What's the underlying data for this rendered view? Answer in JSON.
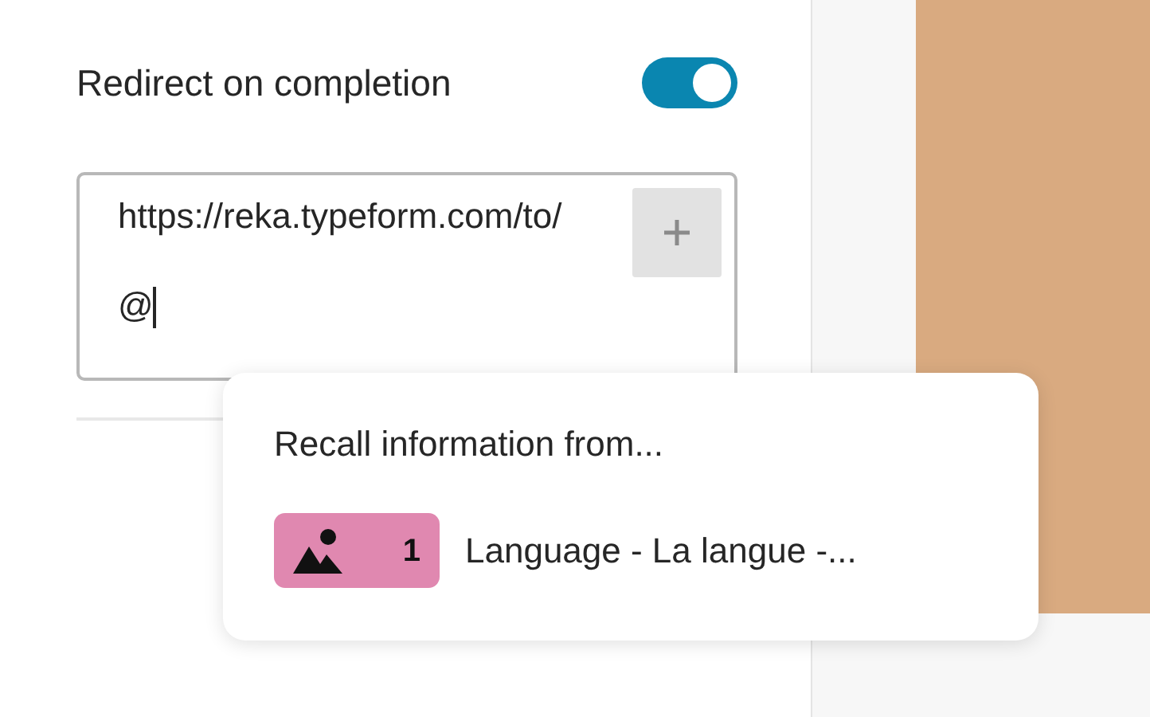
{
  "setting": {
    "label": "Redirect on completion",
    "on": true
  },
  "url_field": {
    "value": "https://reka.typeform.com/to/@",
    "focused": true
  },
  "recall_menu": {
    "title": "Recall information from...",
    "items": [
      {
        "kind": "picture",
        "number": "1",
        "label": "Language - La langue -..."
      }
    ]
  }
}
